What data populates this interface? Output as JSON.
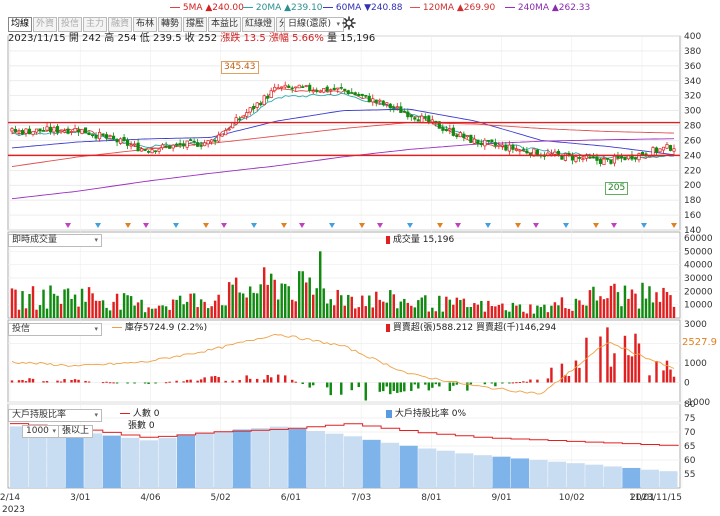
{
  "legend": {
    "ma5": "5MA ▲240.00",
    "ma20": "20MA ▲239.10",
    "ma60": "60MA ▼240.88",
    "ma120": "120MA ▲269.90",
    "ma240": "240MA ▲262.33"
  },
  "colors": {
    "ma5": "#e04040",
    "ma20": "#2aa8a8",
    "ma60": "#3b3bd0",
    "ma120": "#e05050",
    "ma240": "#9a2fc0",
    "up": "#e02020",
    "down": "#108a10",
    "hline": "#e02020"
  },
  "toolbar": {
    "tabs": [
      "均線",
      "外資",
      "投信",
      "主力",
      "融資",
      "布林",
      "轉勢",
      "撐壓",
      "本益比",
      "紅綠燈",
      "分價量"
    ],
    "period": "日線(還原)",
    "period_arrow": "▾",
    "settings_icon": "gear-icon"
  },
  "info": {
    "date": "2023/11/15",
    "high_label": "高",
    "high": "254",
    "low_label": "低",
    "low": "239.5",
    "close_label": "收",
    "close": "252",
    "change_label": "漲跌",
    "change": "13.5",
    "pct_label": "漲幅",
    "pct": "5.66%",
    "vol_label": "量",
    "vol": "15,196",
    "open_label": "開",
    "open": "242"
  },
  "annotations": {
    "high_mark": "345.43",
    "low_mark": "205"
  },
  "panel_vol": {
    "select": "即時成交量",
    "legend": "成交量 15,196"
  },
  "panel_inst": {
    "select": "投信",
    "legend1": "庫存5724.9 (2.2%)",
    "legend2": "買賣超(張)588.212 買賣超(千)146,294",
    "marker": "2527.9"
  },
  "panel_holder": {
    "select": "大戶持股比率",
    "legend1": "人數 0",
    "legend2": "張數 0",
    "legend3": "大戶持股比率 0%",
    "size_select": "1000",
    "size_suffix": "張以上"
  },
  "x_labels": [
    "2/14",
    "3/01",
    "4/06",
    "5/02",
    "6/01",
    "7/03",
    "8/01",
    "9/01",
    "10/02",
    "11/01",
    "2023/11/15"
  ],
  "x_year": "2023",
  "chart_data": [
    {
      "type": "candlestick",
      "title": "",
      "ylim": [
        140,
        400
      ],
      "y_ticks": [
        140,
        160,
        180,
        200,
        220,
        240,
        260,
        280,
        300,
        320,
        340,
        360,
        380,
        400
      ],
      "x": [
        "2/14",
        "3/01",
        "4/06",
        "5/02",
        "6/01",
        "7/03",
        "8/01",
        "9/01",
        "10/02",
        "11/01",
        "11/15"
      ],
      "close": [
        272,
        275,
        248,
        258,
        330,
        328,
        296,
        258,
        242,
        232,
        252
      ],
      "series": [
        {
          "name": "5MA",
          "values": [
            270,
            276,
            249,
            258,
            328,
            326,
            297,
            258,
            242,
            234,
            240
          ]
        },
        {
          "name": "20MA",
          "values": [
            268,
            272,
            252,
            258,
            318,
            322,
            298,
            262,
            246,
            238,
            239.1
          ]
        },
        {
          "name": "60MA",
          "values": [
            250,
            258,
            262,
            264,
            286,
            300,
            302,
            286,
            260,
            252,
            240.88
          ]
        },
        {
          "name": "120MA",
          "values": [
            225,
            238,
            248,
            256,
            266,
            276,
            284,
            282,
            276,
            272,
            269.9
          ]
        },
        {
          "name": "240MA",
          "values": [
            182,
            192,
            205,
            216,
            226,
            238,
            248,
            255,
            259,
            261,
            262.33
          ]
        }
      ],
      "hlines": [
        284,
        240
      ],
      "high_mark": 345.43,
      "low_mark": 205
    },
    {
      "type": "bar",
      "title": "",
      "ylim": [
        0,
        60000
      ],
      "y_ticks": [
        10000,
        20000,
        30000,
        40000,
        50000,
        60000
      ],
      "x": [
        "2/14",
        "3/01",
        "4/06",
        "5/02",
        "6/01",
        "7/03",
        "8/01",
        "9/01",
        "10/02",
        "11/01",
        "11/15"
      ],
      "values": [
        14000,
        18000,
        9000,
        15000,
        26000,
        16000,
        12000,
        9000,
        7000,
        18000,
        15196
      ]
    },
    {
      "type": "bar",
      "title": "",
      "ylim": [
        -1000,
        3000
      ],
      "y_ticks": [
        -1000,
        0,
        1000,
        2000,
        3000
      ],
      "x": [
        "2/14",
        "3/01",
        "4/06",
        "5/02",
        "6/01",
        "7/03",
        "8/01",
        "9/01",
        "10/02",
        "11/01",
        "11/15"
      ],
      "values": [
        150,
        100,
        -80,
        200,
        350,
        -700,
        -300,
        -250,
        200,
        2300,
        588
      ],
      "series": [
        {
          "name": "庫存",
          "values": [
            5900,
            5800,
            5900,
            6200,
            6600,
            6300,
            5600,
            5300,
            5100,
            6400,
            5724.9
          ]
        }
      ]
    },
    {
      "type": "area",
      "title": "",
      "ylim": [
        50,
        80
      ],
      "y_ticks": [
        55,
        60,
        65,
        70,
        75,
        80
      ],
      "x": [
        "2/14",
        "3/01",
        "4/06",
        "5/02",
        "6/01",
        "7/03",
        "8/01",
        "9/01",
        "10/02",
        "11/01",
        "11/15"
      ],
      "values": [
        72,
        70,
        67,
        70,
        72,
        69,
        65,
        62,
        60,
        58,
        56
      ],
      "series": [
        {
          "name": "人數",
          "values": [
            73,
            71,
            68,
            70,
            71,
            73,
            70,
            68,
            67,
            66,
            65
          ]
        }
      ]
    }
  ]
}
